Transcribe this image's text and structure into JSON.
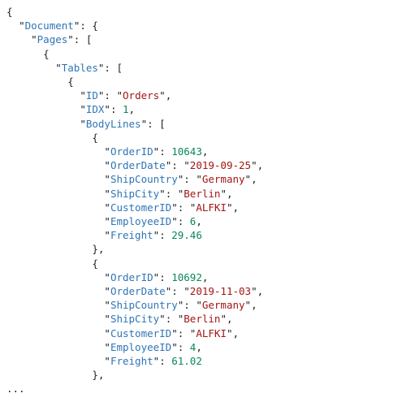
{
  "keys": {
    "Document": "Document",
    "Pages": "Pages",
    "Tables": "Tables",
    "ID": "ID",
    "IDX": "IDX",
    "BodyLines": "BodyLines",
    "OrderID": "OrderID",
    "OrderDate": "OrderDate",
    "ShipCountry": "ShipCountry",
    "ShipCity": "ShipCity",
    "CustomerID": "CustomerID",
    "EmployeeID": "EmployeeID",
    "Freight": "Freight"
  },
  "table": {
    "ID": "Orders",
    "IDX": 1
  },
  "rows": [
    {
      "OrderID": 10643,
      "OrderDate": "2019-09-25",
      "ShipCountry": "Germany",
      "ShipCity": "Berlin",
      "CustomerID": "ALFKI",
      "EmployeeID": 6,
      "Freight": 29.46
    },
    {
      "OrderID": 10692,
      "OrderDate": "2019-11-03",
      "ShipCountry": "Germany",
      "ShipCity": "Berlin",
      "CustomerID": "ALFKI",
      "EmployeeID": 4,
      "Freight": 61.02
    }
  ],
  "ellipsis": "..."
}
